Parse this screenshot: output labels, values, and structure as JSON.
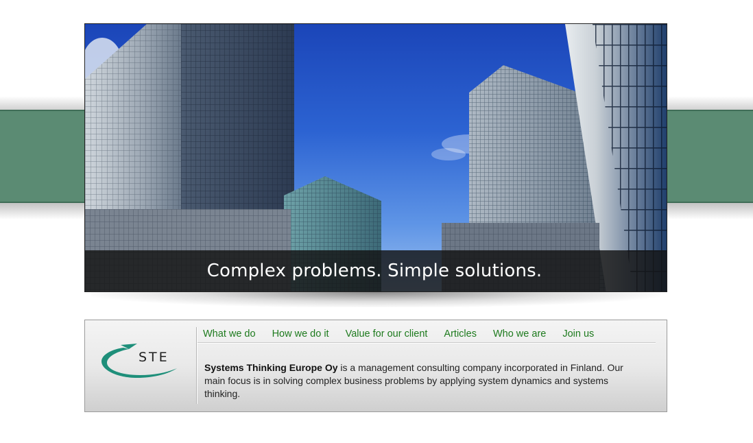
{
  "hero": {
    "caption": "Complex problems. Simple solutions."
  },
  "logo": {
    "text": "STE"
  },
  "nav": {
    "items": [
      {
        "label": "What we do"
      },
      {
        "label": "How we do it"
      },
      {
        "label": "Value for our client"
      },
      {
        "label": "Articles"
      },
      {
        "label": "Who we are"
      },
      {
        "label": "Join us"
      }
    ]
  },
  "intro": {
    "company_name": "Systems Thinking Europe Oy",
    "text": " is a management consulting company incorporated in Finland. Our main focus is in solving complex business problems by applying system dynamics and systems thinking."
  },
  "colors": {
    "band": "#5b8b73",
    "nav_link": "#1d7a1d",
    "logo_swoosh": "#1e8f7a"
  }
}
